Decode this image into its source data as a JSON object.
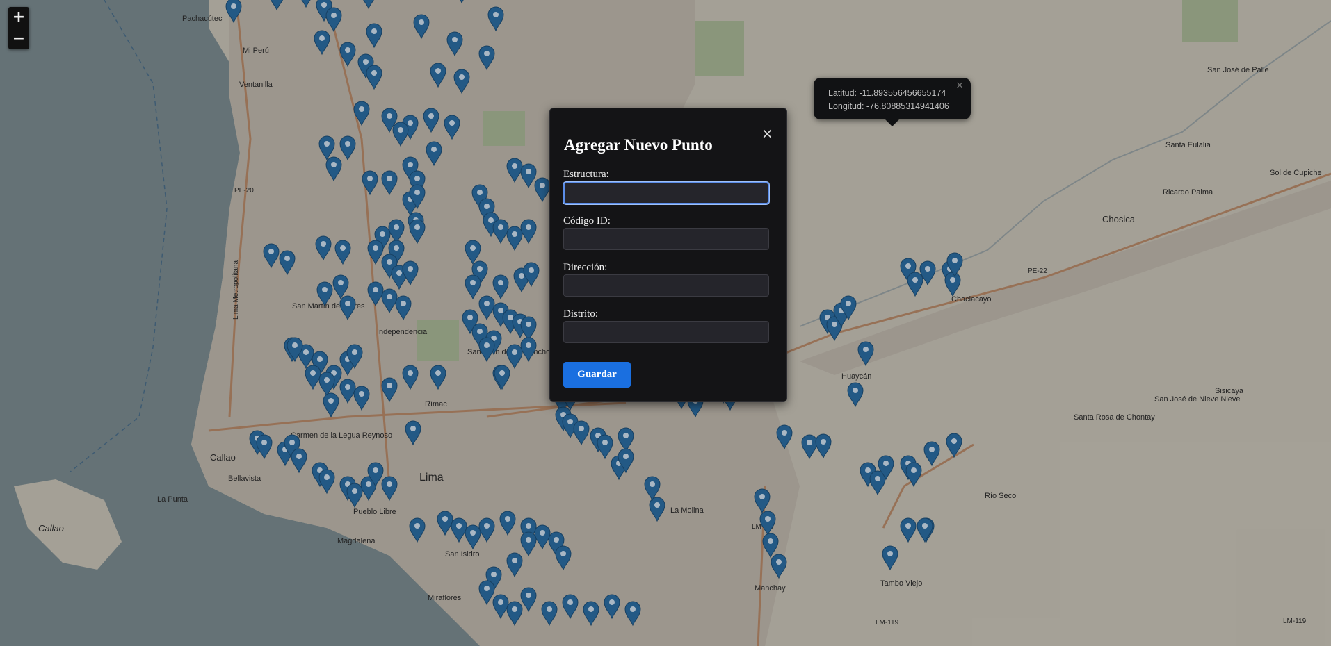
{
  "zoom": {
    "in_label": "+",
    "out_label": "−"
  },
  "popup": {
    "lat_text": "Latitud: -11.893556456655174",
    "lng_text": "Longitud: -76.80885314941406",
    "close": "×"
  },
  "modal": {
    "title": "Agregar Nuevo Punto",
    "close": "×",
    "fields": [
      {
        "label": "Estructura:",
        "value": ""
      },
      {
        "label": "Código ID:",
        "value": ""
      },
      {
        "label": "Dirección:",
        "value": ""
      },
      {
        "label": "Distrito:",
        "value": ""
      }
    ],
    "submit_label": "Guardar"
  },
  "map_labels": [
    "Pachacútec",
    "Mi Perú",
    "Ventanilla",
    "Callao",
    "Bellavista",
    "La Punta",
    "Callao",
    "Carmen de la Legua Reynoso",
    "Lima",
    "San Martín de Porres",
    "Independencia",
    "Rímac",
    "San Juan de Lurigancho",
    "Magdalena",
    "Pueblo Libre",
    "San Isidro",
    "Miraflores",
    "La Molina",
    "Manchay",
    "Tambo Viejo",
    "Huaycán",
    "Chaclacayo",
    "Chosica",
    "Santa Eulalia",
    "San José de Palle",
    "Sol de Cupiche",
    "Ricardo Palma",
    "San José de Nieve Nieve",
    "Santa Rosa de Chontay",
    "Sisicaya",
    "Río Seco",
    "PE-20",
    "PE-22",
    "LM-117",
    "LM-119",
    "LM-119",
    "Lima Metropolitana"
  ],
  "colors": {
    "marker": "#2b6da3",
    "button": "#1a6fe0",
    "modal_bg": "#141416"
  }
}
